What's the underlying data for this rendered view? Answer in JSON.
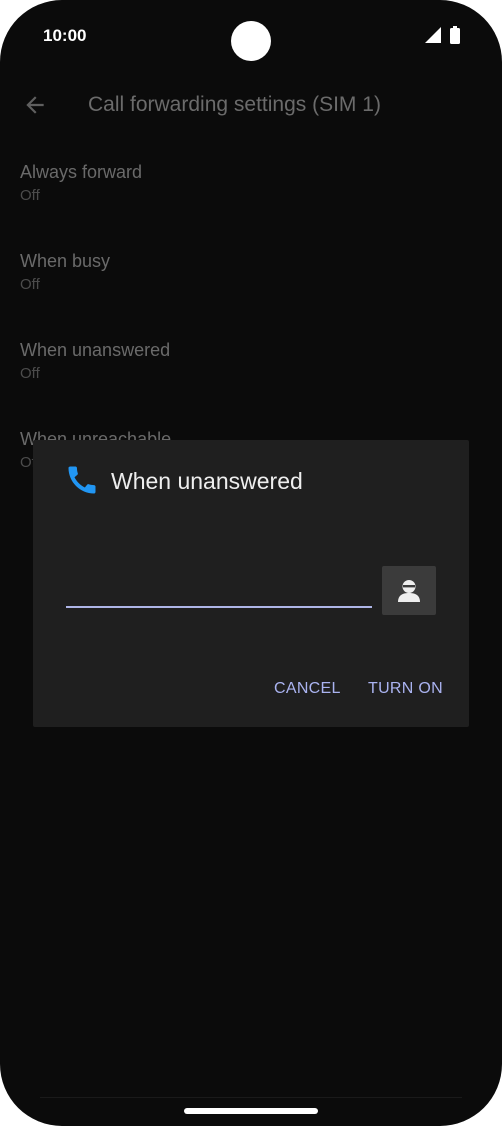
{
  "status_bar": {
    "time": "10:00"
  },
  "app_bar": {
    "title": "Call forwarding settings (SIM 1)"
  },
  "preferences": [
    {
      "title": "Always forward",
      "summary": "Off"
    },
    {
      "title": "When busy",
      "summary": "Off"
    },
    {
      "title": "When unanswered",
      "summary": "Off"
    },
    {
      "title": "When unreachable",
      "summary": "Off"
    }
  ],
  "dialog": {
    "title": "When unanswered",
    "number_value": "",
    "cancel_label": "CANCEL",
    "turn_on_label": "TURN ON"
  },
  "colors": {
    "accent": "#aab3f0",
    "phone_icon": "#2196f3",
    "dialog_bg": "#1f1f1f",
    "screen_bg": "#0b0b0b"
  }
}
